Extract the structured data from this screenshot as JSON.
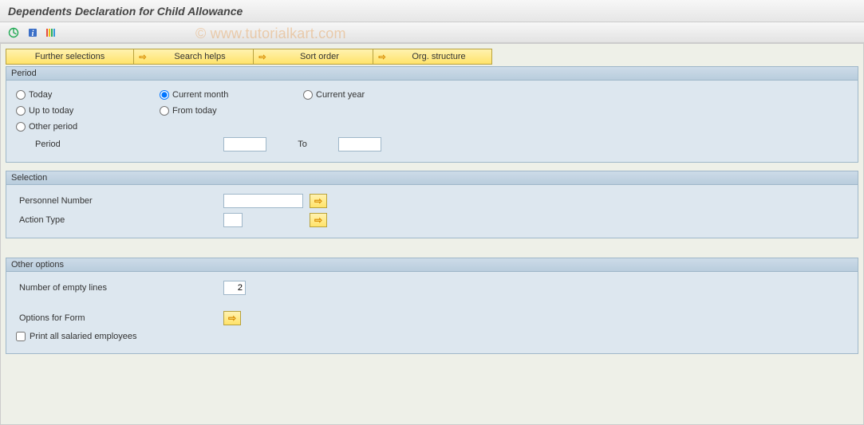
{
  "title": "Dependents Declaration for Child Allowance",
  "watermark": "© www.tutorialkart.com",
  "toolbar": {
    "execute": "Execute",
    "info": "Information",
    "variants": "Variants"
  },
  "buttons": {
    "further": "Further selections",
    "search": "Search helps",
    "sort": "Sort order",
    "org": "Org. structure"
  },
  "period": {
    "legend": "Period",
    "radios": {
      "today": "Today",
      "current_month": "Current month",
      "current_year": "Current year",
      "up_to_today": "Up to today",
      "from_today": "From today",
      "other_period": "Other period"
    },
    "selected": "current_month",
    "period_label": "Period",
    "to_label": "To",
    "period_value": "",
    "to_value": ""
  },
  "selection": {
    "legend": "Selection",
    "personnel_label": "Personnel Number",
    "personnel_value": "",
    "action_label": "Action Type",
    "action_value": ""
  },
  "other": {
    "legend": "Other options",
    "empty_lines_label": "Number of empty lines",
    "empty_lines_value": "2",
    "form_label": "Options for Form",
    "print_all_label": "Print all salaried employees",
    "print_all_checked": false
  }
}
